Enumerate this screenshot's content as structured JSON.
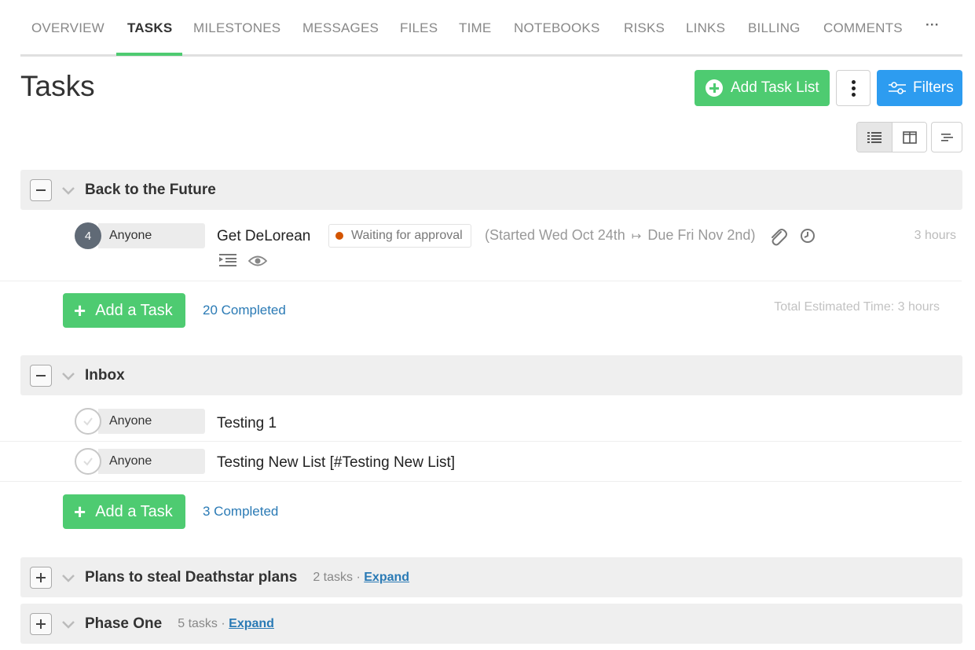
{
  "nav": {
    "tabs": [
      {
        "label": "OVERVIEW"
      },
      {
        "label": "TASKS",
        "active": true
      },
      {
        "label": "MILESTONES"
      },
      {
        "label": "MESSAGES"
      },
      {
        "label": "FILES"
      },
      {
        "label": "TIME"
      },
      {
        "label": "NOTEBOOKS"
      },
      {
        "label": "RISKS"
      },
      {
        "label": "LINKS"
      },
      {
        "label": "BILLING"
      },
      {
        "label": "COMMENTS"
      }
    ],
    "more_label": "···",
    "active_color": "#4ecb71"
  },
  "header": {
    "title": "Tasks",
    "add_task_list_label": "Add Task List",
    "filters_label": "Filters",
    "add_color": "#4ecb71",
    "filters_color": "#2d9cf0"
  },
  "view_toggles": [
    "list-view-icon",
    "board-view-icon",
    "gantt-view-icon"
  ],
  "lists": [
    {
      "title": "Back to the Future",
      "expanded": true,
      "tasks": [
        {
          "number": "4",
          "assignee": "Anyone",
          "name": "Get DeLorean",
          "status": "Waiting for approval",
          "status_color": "#d35400",
          "started_prefix": "(Started",
          "start_date": "Wed Oct 24th",
          "arrow": "↦",
          "due_prefix": "Due",
          "due_date": "Fri Nov 2nd)",
          "estimate": "3 hours"
        }
      ],
      "add_task_label": "Add a Task",
      "completed_label": "20 Completed",
      "total_estimate": "Total Estimated Time: 3 hours"
    },
    {
      "title": "Inbox",
      "expanded": true,
      "tasks": [
        {
          "assignee": "Anyone",
          "name": "Testing 1"
        },
        {
          "assignee": "Anyone",
          "name": "Testing New List [#Testing New List]"
        }
      ],
      "add_task_label": "Add a Task",
      "completed_label": "3 Completed"
    },
    {
      "title": "Plans to steal Deathstar plans",
      "expanded": false,
      "task_count": "2 tasks ·",
      "expand_label": "Expand"
    },
    {
      "title": "Phase One",
      "expanded": false,
      "task_count": "5 tasks ·",
      "expand_label": "Expand"
    }
  ]
}
